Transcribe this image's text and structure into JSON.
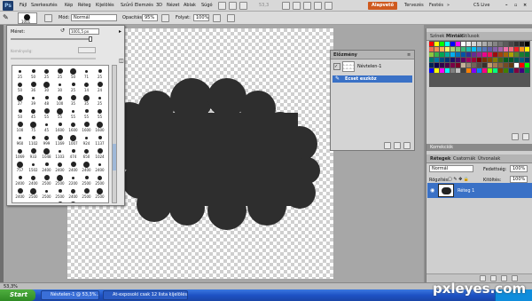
{
  "menubar": {
    "app_logo": "Ps",
    "items": [
      "Fájl",
      "Szerkesztés",
      "Kép",
      "Réteg",
      "Kijelölés",
      "Szűrő",
      "Elemzés",
      "3D",
      "Nézet",
      "Ablak",
      "Súgó"
    ],
    "zoom": "53,3",
    "workspaces": [
      "Alapvető",
      "Tervezés",
      "Festés"
    ],
    "more": "»",
    "cslive": "CS Live"
  },
  "options": {
    "brush_size": "1001",
    "mode_label": "Mód:",
    "mode_value": "Normál",
    "opacity_label": "Opacitás:",
    "opacity_value": "95%",
    "flow_label": "Folyat:",
    "flow_value": "100%"
  },
  "brush_panel": {
    "size_label": "Méret:",
    "size_value": "1001,5 px",
    "hardness_label": "Keménység:",
    "brushes": [
      {
        "n": "25"
      },
      {
        "n": "50"
      },
      {
        "n": "25"
      },
      {
        "n": "25"
      },
      {
        "n": "50"
      },
      {
        "n": "71"
      },
      {
        "n": "25"
      },
      {
        "n": "50"
      },
      {
        "n": "36"
      },
      {
        "n": "30"
      },
      {
        "n": "30"
      },
      {
        "n": "25"
      },
      {
        "n": "14"
      },
      {
        "n": "24"
      },
      {
        "n": "27"
      },
      {
        "n": "39"
      },
      {
        "n": "48"
      },
      {
        "n": "100"
      },
      {
        "n": "35"
      },
      {
        "n": "35"
      },
      {
        "n": "25"
      },
      {
        "n": "50"
      },
      {
        "n": "45"
      },
      {
        "n": "55"
      },
      {
        "n": "55"
      },
      {
        "n": "55"
      },
      {
        "n": "55"
      },
      {
        "n": "55"
      },
      {
        "n": "100"
      },
      {
        "n": "75"
      },
      {
        "n": "45"
      },
      {
        "n": "1600"
      },
      {
        "n": "1600"
      },
      {
        "n": "1600"
      },
      {
        "n": "1600"
      },
      {
        "n": "960"
      },
      {
        "n": "1102"
      },
      {
        "n": "999"
      },
      {
        "n": "1169"
      },
      {
        "n": "1007"
      },
      {
        "n": "924"
      },
      {
        "n": "1137"
      },
      {
        "n": "1069"
      },
      {
        "n": "933"
      },
      {
        "n": "1048"
      },
      {
        "n": "1103"
      },
      {
        "n": "474"
      },
      {
        "n": "650"
      },
      {
        "n": "1024"
      },
      {
        "n": "757"
      },
      {
        "n": "1502"
      },
      {
        "n": "2400"
      },
      {
        "n": "2400"
      },
      {
        "n": "2400"
      },
      {
        "n": "2400"
      },
      {
        "n": "2400"
      },
      {
        "n": "2400"
      },
      {
        "n": "2400"
      },
      {
        "n": "2500"
      },
      {
        "n": "2500"
      },
      {
        "n": "2200"
      },
      {
        "n": "2500"
      },
      {
        "n": "2500"
      },
      {
        "n": "2400"
      },
      {
        "n": "2500"
      },
      {
        "n": "2500"
      },
      {
        "n": "2500"
      },
      {
        "n": "2400"
      },
      {
        "n": "2500"
      },
      {
        "n": "2500"
      },
      {
        "n": "2500"
      },
      {
        "n": "2400"
      },
      {
        "n": "2200"
      },
      {
        "n": "2000"
      },
      {
        "n": "1024"
      },
      {
        "n": "1024"
      },
      {
        "n": "1024"
      },
      {
        "n": "1024"
      },
      {
        "n": "1024"
      },
      {
        "n": "1024"
      },
      {
        "n": "1024"
      },
      {
        "n": "1024"
      },
      {
        "n": "1024"
      },
      {
        "n": "1024"
      },
      {
        "n": "1001"
      },
      {
        "n": "1001"
      },
      {
        "n": "1001"
      }
    ]
  },
  "history": {
    "tab": "Előzmény",
    "snapshot": "Névtelen-1",
    "item": "Ecset eszköz"
  },
  "swatches": {
    "tabs": [
      "Színek",
      "Minták",
      "Stílusok"
    ],
    "colors": [
      "#ff0000",
      "#ffff00",
      "#00ff00",
      "#00ffff",
      "#0000ff",
      "#ff00ff",
      "#ffffff",
      "#ebebeb",
      "#d6d6d6",
      "#c2c2c2",
      "#adadad",
      "#999999",
      "#858585",
      "#707070",
      "#5c5c5c",
      "#474747",
      "#333333",
      "#1f1f1f",
      "#000000",
      "#f26c4f",
      "#f68e55",
      "#fbaf5c",
      "#fff467",
      "#acd372",
      "#7cc576",
      "#3bb878",
      "#1abbb4",
      "#00bff3",
      "#438cca",
      "#5574b9",
      "#605ca8",
      "#855fa8",
      "#a763a8",
      "#f06ea9",
      "#f26d7d",
      "#ee1d24",
      "#f7941d",
      "#fff200",
      "#8dc63f",
      "#39b54a",
      "#00a651",
      "#00a99d",
      "#00aeef",
      "#0072bc",
      "#0054a6",
      "#2e3192",
      "#662d91",
      "#92278f",
      "#ec008c",
      "#ed145b",
      "#9e0b0f",
      "#a0410d",
      "#a3620a",
      "#aba000",
      "#598527",
      "#197b30",
      "#007236",
      "#00746b",
      "#0076a3",
      "#004b80",
      "#003471",
      "#1b1464",
      "#440e62",
      "#630460",
      "#9e005d",
      "#9e0039",
      "#790000",
      "#7b2e00",
      "#7d4900",
      "#827b00",
      "#406618",
      "#005e20",
      "#005826",
      "#005952",
      "#005b7f",
      "#003663",
      "#002157",
      "#0d004c",
      "#32004b",
      "#4b0049",
      "#7b0046",
      "#7a0026",
      "#c7b299",
      "#998675",
      "#736357",
      "#534741",
      "#37302d",
      "#c69c6d",
      "#a67c52",
      "#8c6239",
      "#754c24",
      "#603913",
      "#ffffff",
      "#ff0000",
      "#00ff00",
      "#0000ff",
      "#ffff00",
      "#ff00ff",
      "#00ffff",
      "#808080",
      "#c0c0c0",
      "#404040",
      "#ff8000",
      "#8000ff",
      "#0080ff",
      "#ff0080",
      "#80ff00",
      "#00ff80",
      "#804000",
      "#408000",
      "#004080",
      "#800040",
      "#400080",
      "#008040"
    ]
  },
  "layers": {
    "tabs": [
      "Rétegek",
      "Csatornák",
      "Útvonalak"
    ],
    "blend": "Normál",
    "opacity_label": "Fedettség:",
    "opacity": "100%",
    "lock_label": "Rögzítés:",
    "fill_label": "Kitöltés:",
    "fill": "100%",
    "layer_name": "Réteg 1"
  },
  "status": {
    "zoom": "53,3%"
  },
  "taskbar": {
    "start": "Start",
    "tasks": [
      "Névtelen-1 @ 53,3%...",
      "At-exposoki csak 12 lista kijelölés..."
    ]
  },
  "watermark": "pxleyes.com"
}
